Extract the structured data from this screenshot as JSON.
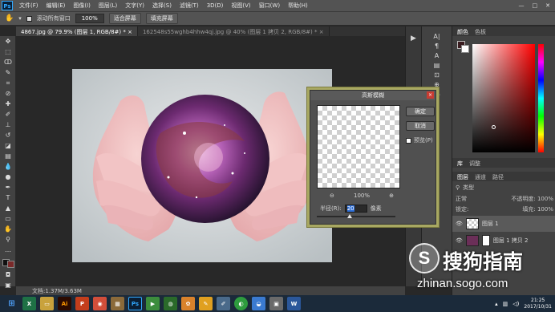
{
  "app": {
    "logo": "Ps"
  },
  "menu": [
    "文件(F)",
    "编辑(E)",
    "图像(I)",
    "图层(L)",
    "文字(Y)",
    "选择(S)",
    "滤镜(T)",
    "3D(D)",
    "视图(V)",
    "窗口(W)",
    "帮助(H)"
  ],
  "window_buttons": [
    "—",
    "□",
    "✕"
  ],
  "options_bar": {
    "scroll_all": "滚动所有窗口",
    "zoom": "100%",
    "fit_screen": "适合屏幕",
    "fill_screen": "填充屏幕"
  },
  "tabs": [
    {
      "label": "4867.jpg @ 79.9% (图层 1, RGB/8#) *  ×",
      "active": true
    },
    {
      "label": "162548s55wghb4hhw4qj.jpg @ 40% (图层 1 拷贝 2, RGB/8#) *  ×",
      "active": false
    }
  ],
  "status": {
    "doc": "文档:1.37M/3.63M"
  },
  "right_panel": {
    "color_tabs": [
      "颜色",
      "色板"
    ],
    "adjust_tabs": [
      "库",
      "调整"
    ],
    "layer_tabs": [
      "图层",
      "通道",
      "路径"
    ],
    "kind": "类型",
    "blend": "正常",
    "opacity": "不透明度: 100%",
    "fill": "填充: 100%",
    "lock": "锁定:",
    "layers": [
      {
        "name": "图层 1"
      },
      {
        "name": "图层 1 拷贝 2"
      }
    ]
  },
  "dialog": {
    "title": "高斯模糊",
    "ok": "确定",
    "cancel": "取消",
    "preview": "预览(P)",
    "zoom": "100%",
    "radius_label": "半径(R):",
    "radius_value": "20",
    "radius_unit": "像素"
  },
  "watermark": {
    "brand": "搜狗指南",
    "url": "zhinan.sogo.com"
  },
  "clock": {
    "time": "21:25",
    "date": "2017/10/31"
  },
  "colors": {
    "accent_dialog": "#a8a862",
    "ps_blue": "#31a8ff"
  }
}
